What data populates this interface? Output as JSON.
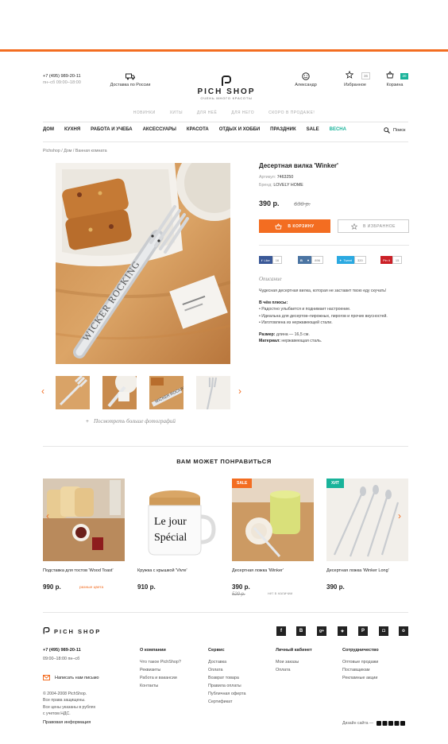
{
  "header": {
    "phone": "+7 (495) 989-20-11",
    "hours": "пн–сб  09:00–18:00",
    "delivery": "Доставка по России",
    "logo_word": "PICH SHOP",
    "logo_tag": "ОЧЕНЬ МНОГО КРАСОТЫ",
    "user_name": "Александр",
    "favorites_label": "Избранное",
    "favorites_count": "36",
    "cart_label": "Корзина",
    "cart_count": "20"
  },
  "subnav": [
    "НОВИНКИ",
    "ХИТЫ",
    "ДЛЯ НЕЁ",
    "ДЛЯ НЕГО",
    "СКОРО В ПРОДАЖЕ!"
  ],
  "mainnav": [
    "ДОМ",
    "КУХНЯ",
    "РАБОТА И УЧЕБА",
    "АКСЕССУАРЫ",
    "КРАСОТА",
    "ОТДЫХ И ХОББИ",
    "ПРАЗДНИК",
    "SALE",
    "ВЕСНА"
  ],
  "search_label": "Поиск",
  "breadcrumbs": [
    "Pichshop",
    "Дом",
    "Ванная комната"
  ],
  "more_photos": "Посмотреть больше фотографий",
  "product": {
    "title": "Десертная вилка 'Winker'",
    "article_label": "Артикул:",
    "article": "7463250",
    "brand_label": "Бренд:",
    "brand": "LOVELY HOME",
    "price": "390 р.",
    "old_price": "630 р.",
    "cart_button": "В КОРЗИНУ",
    "fav_button": "В ИЗБРАННОЕ"
  },
  "share": {
    "fb_label": "Like",
    "fb_count": "16",
    "vk_count": "896",
    "tw_label": "Tweet",
    "tw_count": "320",
    "pin_label": "Pin it",
    "pin_count": "15"
  },
  "description": {
    "heading": "Описание",
    "intro": "Чудесная десертная вилка, которая не заставит твою еду скучать!",
    "plus_heading": "В чём плюсы:",
    "plus_items": [
      "• Радостно улыбается и поднимает настроение.",
      "• Идеальна для десертов–пирожных, пирогов и прочих вкусностей.",
      "• Изготовлена из нержавеющей стали."
    ],
    "size_label": "Размер:",
    "size_value": "длина — 16,5 см.",
    "material_label": "Материал:",
    "material_value": "нержавеющая сталь."
  },
  "recommend": {
    "title": "ВАМ МОЖЕТ ПОНРАВИТЬСЯ",
    "items": [
      {
        "name": "Подставка для тостов 'Wood Toast'",
        "price": "990 р.",
        "note": "разные цвета",
        "badge": ""
      },
      {
        "name": "Кружка с крышкой 'Vivre'",
        "price": "910 р.",
        "note": "",
        "badge": ""
      },
      {
        "name": "Десертная ложка 'Winker'",
        "price": "390 р.",
        "old_price": "520 р.",
        "note": "нет в наличии",
        "badge": "SALE"
      },
      {
        "name": "Десертная ложка 'Winker Long'",
        "price": "390 р.",
        "note": "",
        "badge": "ХИТ"
      }
    ],
    "mug_text_1": "Le jour",
    "mug_text_2": "Spécial"
  },
  "footer": {
    "logo": "PICH SHOP",
    "phone": "+7 (495) 989-20-11",
    "hours": "09:00–18:00 пн–сб",
    "write": "Написать нам письмо",
    "copy": [
      "© 2004-2008 PichShop.",
      "Все права защищены.",
      "Все цены указаны в рублях",
      "с учетом НДС."
    ],
    "legal": "Правовая информация",
    "design": "Дизайн сайта —",
    "columns": [
      {
        "title": "О компании",
        "items": [
          "Что такое PichShop?",
          "Реквизиты",
          "Работа и вакансии",
          "Контакты"
        ]
      },
      {
        "title": "Сервис",
        "items": [
          "Доставка",
          "Оплата",
          "Возврат товара",
          "Правила оплаты",
          "Публичная оферта",
          "Сертификат"
        ]
      },
      {
        "title": "Личный кабинет",
        "items": [
          "Мои заказы",
          "Оплата"
        ]
      },
      {
        "title": "Сотрудничество",
        "items": [
          "Оптовые продажи",
          "Поставщикам",
          "Рекламные акции"
        ]
      }
    ],
    "social_icons": [
      "facebook-icon",
      "vk-icon",
      "googleplus-icon",
      "twitter-icon",
      "pinterest-icon",
      "instagram-icon",
      "odnoklassniki-icon"
    ]
  },
  "colors": {
    "accent": "#f36d21",
    "spring": "#19b39a"
  }
}
